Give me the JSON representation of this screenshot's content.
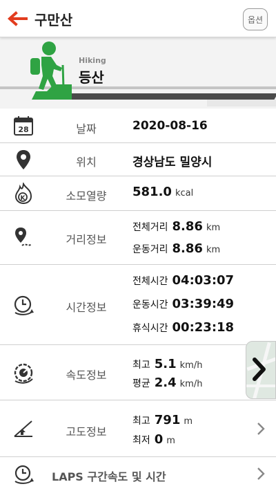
{
  "header": {
    "title": "구만산",
    "options_label": "옵션"
  },
  "activity": {
    "sub": "Hiking",
    "name": "등산"
  },
  "rows": {
    "date": {
      "label": "날짜",
      "value": "2020-08-16"
    },
    "location": {
      "label": "위치",
      "value": "경상남도 밀양시"
    },
    "calories": {
      "label": "소모열량",
      "value": "581.0",
      "unit": "kcal"
    },
    "distance": {
      "label": "거리정보",
      "total": {
        "key": "전체거리",
        "value": "8.86",
        "unit": "km"
      },
      "moving": {
        "key": "운동거리",
        "value": "8.86",
        "unit": "km"
      }
    },
    "time": {
      "label": "시간정보",
      "total": {
        "key": "전체시간",
        "value": "04:03:07"
      },
      "moving": {
        "key": "운동시간",
        "value": "03:39:49"
      },
      "rest": {
        "key": "휴식시간",
        "value": "00:23:18"
      }
    },
    "speed": {
      "label": "속도정보",
      "max": {
        "key": "최고",
        "value": "5.1",
        "unit": "km/h"
      },
      "avg": {
        "key": "평균",
        "value": "2.4",
        "unit": "km/h"
      }
    },
    "altitude": {
      "label": "고도정보",
      "max": {
        "key": "최고",
        "value": "791",
        "unit": "m"
      },
      "min": {
        "key": "최저",
        "value": "0",
        "unit": "m"
      }
    },
    "laps": {
      "label": "LAPS 구간속도 및 시간"
    }
  },
  "colors": {
    "accent": "#e23c1e",
    "hero_green": "#2fa343"
  }
}
